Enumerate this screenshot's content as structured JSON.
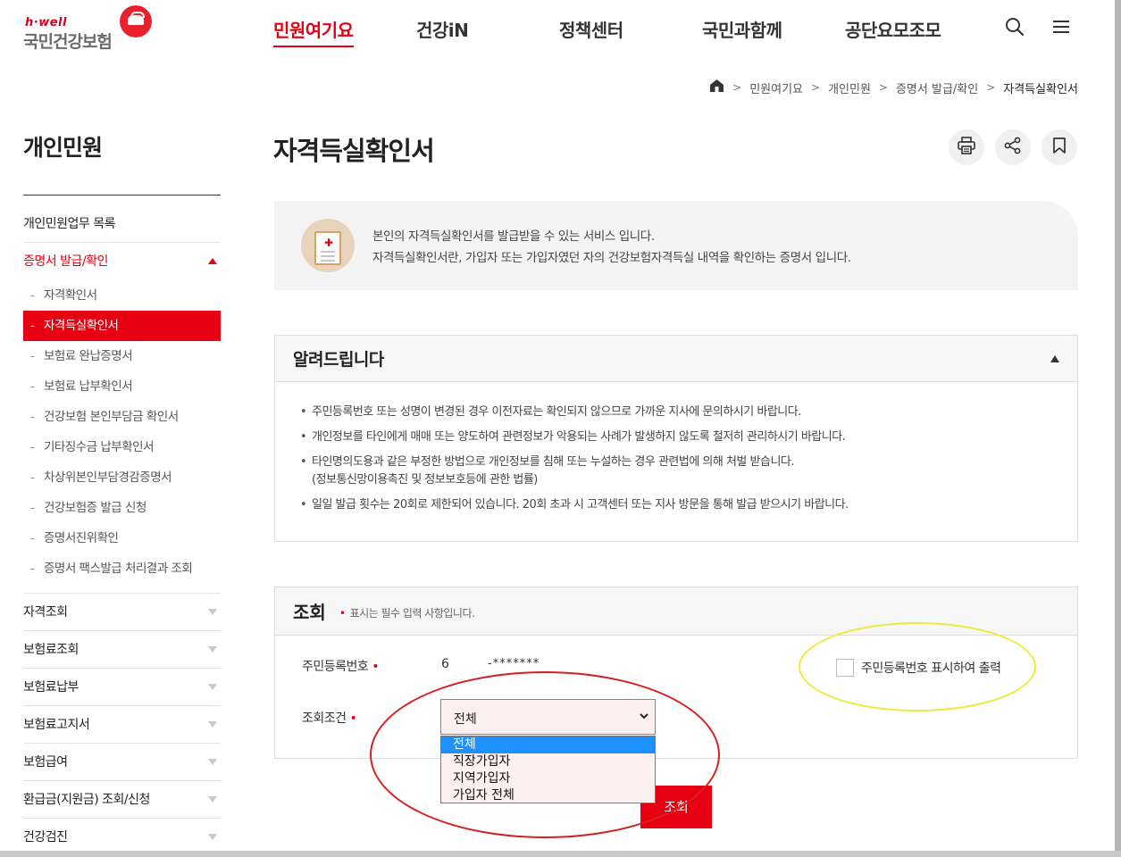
{
  "logo": {
    "tagline": "h·well",
    "name": "국민건강보험"
  },
  "nav": {
    "items": [
      "민원여기요",
      "건강iN",
      "정책센터",
      "국민과함께",
      "공단요모조모"
    ],
    "active_index": 0,
    "search_icon": "search-icon",
    "menu_icon": "hamburger-menu-icon"
  },
  "breadcrumb": {
    "home_icon": "home-icon",
    "items": [
      "민원여기요",
      "개인민원",
      "증명서 발급/확인",
      "자격득실확인서"
    ]
  },
  "sidebar": {
    "title": "개인민원",
    "top_items": [
      {
        "label": "개인민원업무 목록"
      },
      {
        "label": "증명서 발급/확인",
        "open": true
      }
    ],
    "sub_items": [
      "자격확인서",
      "자격득실확인서",
      "보험료 완납증명서",
      "보험료 납부확인서",
      "건강보험 본인부담금 확인서",
      "기타징수금 납부확인서",
      "차상위본인부담경감증명서",
      "건강보험증 발급 신청",
      "증명서진위확인",
      "증명서 팩스발급 처리결과 조회"
    ],
    "active_sub_index": 1,
    "bottom_items": [
      "자격조회",
      "보험료조회",
      "보험료납부",
      "보험료고지서",
      "보험급여",
      "환급금(지원금) 조회/신청",
      "건강검진"
    ]
  },
  "page": {
    "title": "자격득실확인서",
    "tools": [
      "print-icon",
      "share-icon",
      "bookmark-icon"
    ]
  },
  "intro": {
    "line1": "본인의 자격득실확인서를 발급받을 수 있는 서비스 입니다.",
    "line2": "자격득실확인서란, 가입자 또는 가입자였던 자의 건강보험자격득실 내역을 확인하는 증명서 입니다."
  },
  "notice": {
    "title": "알려드립니다",
    "items": [
      {
        "text": "주민등록번호 또는 성명이 변경된 경우 이전자료는 확인되지 않으므로 가까운 지사에 문의하시기 바랍니다.",
        "cont": ""
      },
      {
        "text": "개인정보를 타인에게 매매 또는 양도하여 관련정보가 악용되는 사례가 발생하지 않도록 철저히 관리하시기 바랍니다.",
        "cont": ""
      },
      {
        "text": "타인명의도용과 같은 부정한 방법으로 개인정보를 침해 또는 누설하는 경우 관련법에 의해 처벌 받습니다.",
        "cont": "(정보통신망이용촉진 및 정보보호등에 관한 법률)"
      },
      {
        "text": "일일 발급 횟수는 20회로 제한되어 있습니다. 20회 초과 시 고객센터 또는 지사 방문을 통해 발급 받으시기 바랍니다.",
        "cont": ""
      }
    ]
  },
  "query": {
    "title": "조회",
    "required_note": "표시는 필수 입력 사항입니다.",
    "required_mark": "•",
    "jumin_label": "주민등록번호",
    "jumin_front": "6",
    "jumin_back": "-*******",
    "show_jumin_label": "주민등록번호 표시하여 출력",
    "show_jumin_checked": false,
    "condition_label": "조회조건",
    "condition_value": "전체",
    "condition_options": [
      "전체",
      "직장가입자",
      "지역가입자",
      "가입자 전체"
    ],
    "condition_highlighted_index": 0,
    "submit_label": "조회"
  },
  "annotations": {
    "red_ellipse_color": "#d62020",
    "yellow_ellipse_color": "#eeea3c"
  },
  "colors": {
    "accent": "#e60012"
  }
}
